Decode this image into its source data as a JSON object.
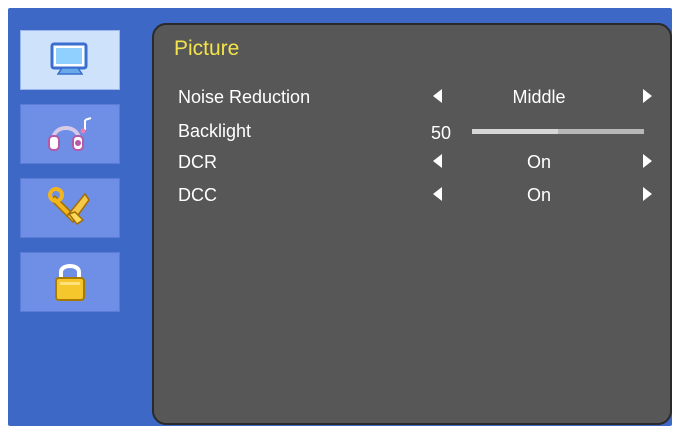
{
  "sidebar": {
    "items": [
      {
        "icon": "monitor-icon",
        "active": true
      },
      {
        "icon": "headphones-icon",
        "active": false
      },
      {
        "icon": "tools-icon",
        "active": false
      },
      {
        "icon": "lock-icon",
        "active": false
      }
    ]
  },
  "panel": {
    "title": "Picture",
    "settings": [
      {
        "label": "Noise Reduction",
        "value": "Middle"
      },
      {
        "label": "Backlight",
        "value": "50",
        "level": 0.5
      },
      {
        "label": "DCR",
        "value": "On"
      },
      {
        "label": "DCC",
        "value": "On"
      }
    ]
  },
  "colors": {
    "frame": "#3d68c6",
    "panel": "#575757",
    "title": "#f3e34a",
    "tab": "#6f8fe6",
    "tab_active": "#cfe2fb"
  }
}
